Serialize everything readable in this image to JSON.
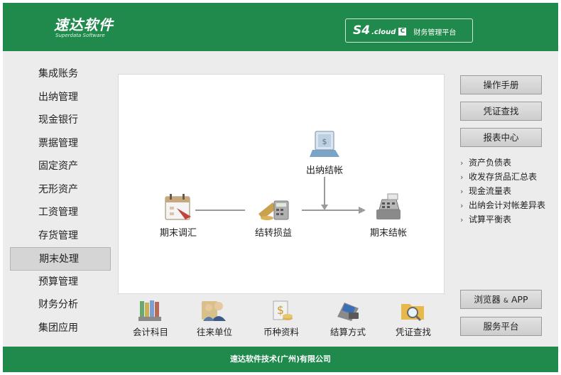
{
  "header": {
    "logo_text": "速达软件",
    "logo_sub": "Superdata Software",
    "badge_s4": "S4",
    "badge_cloud": ".cloud",
    "badge_c": "C",
    "badge_text": "财务管理平台"
  },
  "nav": {
    "items": [
      "集成账务",
      "出纳管理",
      "现金银行",
      "票据管理",
      "固定资产",
      "无形资产",
      "工资管理",
      "存货管理",
      "期末处理",
      "预算管理",
      "财务分析",
      "集团应用"
    ],
    "active": "期末处理"
  },
  "flow": {
    "cashier_close": "出纳结帐",
    "period_adjust": "期末调汇",
    "transfer_pl": "结转损益",
    "period_close": "期末结帐"
  },
  "shortcuts": {
    "accounts": "会计科目",
    "partners": "往来单位",
    "currency": "币种资料",
    "settlement": "结算方式",
    "voucher_query": "凭证查找"
  },
  "side": {
    "manual": "操作手册",
    "voucher_search": "凭证查找",
    "report_center": "报表中心",
    "browser_prefix": "浏览器",
    "browser_amp": "&",
    "browser_suffix": "APP",
    "service": "服务平台"
  },
  "reports": [
    "资产负债表",
    "收发存货品汇总表",
    "现金流量表",
    "出纳会计对帐差异表",
    "试算平衡表"
  ],
  "footer": {
    "company": "速达软件技术(广州)有限公司"
  },
  "colors": {
    "brand_green": "#1f8a4c",
    "panel_gray": "#ececec"
  }
}
